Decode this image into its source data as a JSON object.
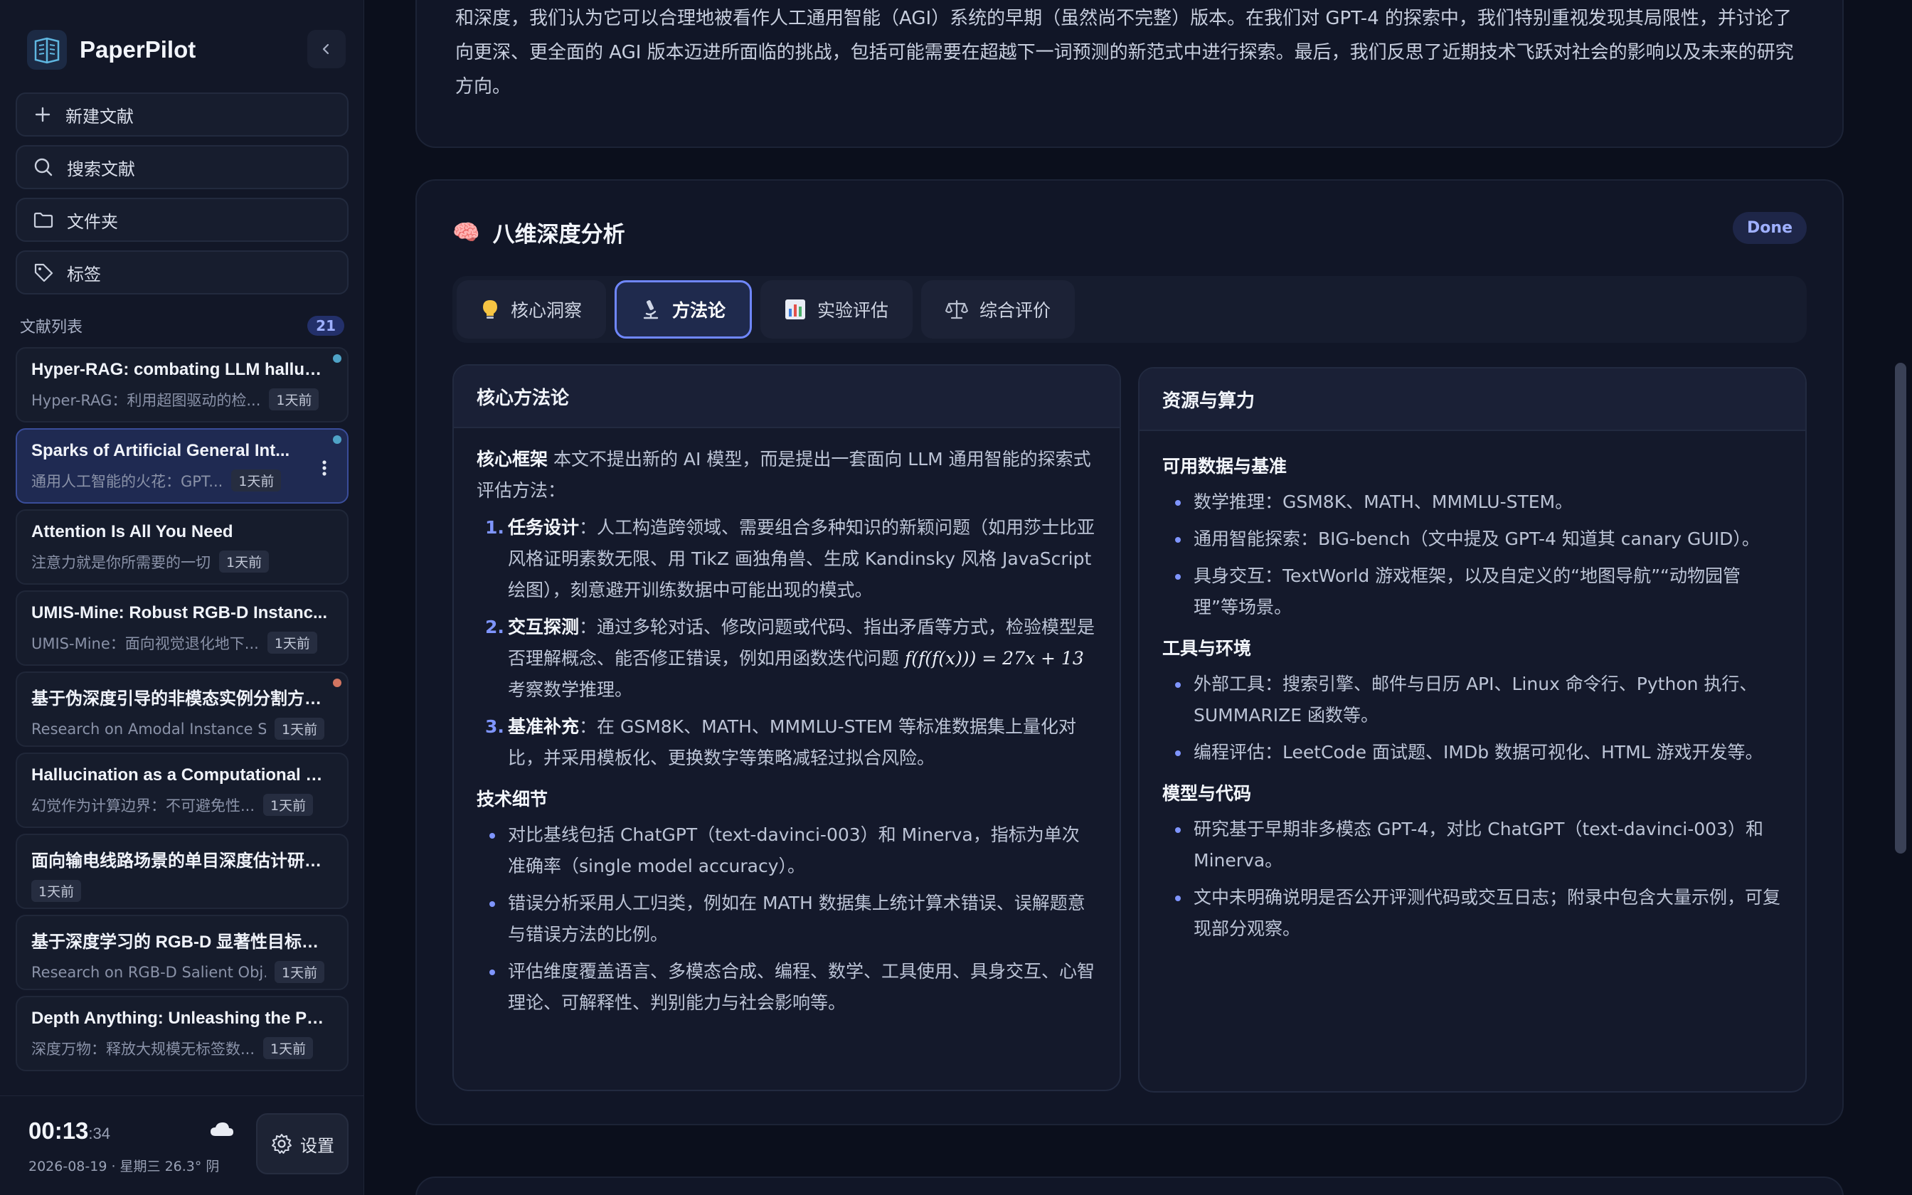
{
  "app": {
    "name": "PaperPilot"
  },
  "sidebar": {
    "nav": [
      {
        "label": "新建文献",
        "icon": "plus-icon"
      },
      {
        "label": "搜索文献",
        "icon": "search-icon"
      },
      {
        "label": "文件夹",
        "icon": "folder-icon"
      },
      {
        "label": "标签",
        "icon": "tag-icon"
      }
    ],
    "list_title": "文献列表",
    "list_count": "21",
    "docs": [
      {
        "title": "Hyper-RAG: combating LLM halluci...",
        "subtitle": "Hyper-RAG：利用超图驱动的检...",
        "time": "1天前",
        "dot": "#4fa3c7"
      },
      {
        "title": "Sparks of Artificial General Int...",
        "subtitle": "通用人工智能的火花：GPT...",
        "time": "1天前",
        "dot": "#4fa3c7"
      },
      {
        "title": "Attention Is All You Need",
        "subtitle": "注意力就是你所需要的一切",
        "time": "1天前"
      },
      {
        "title": "UMIS-Mine: Robust RGB-D Instanc...",
        "subtitle": "UMIS-Mine：面向视觉退化地下...",
        "time": "1天前"
      },
      {
        "title": "基于伪深度引导的非模态实例分割方法...",
        "subtitle": "Research on Amodal Instance S...",
        "time": "1天前",
        "dot": "#d27561"
      },
      {
        "title": "Hallucination as a Computational B...",
        "subtitle": "幻觉作为计算边界：不可避免性...",
        "time": "1天前"
      },
      {
        "title": "面向输电线路场景的单目深度估计研究...",
        "subtitle": "",
        "time": "1天前"
      },
      {
        "title": "基于深度学习的 RGB-D 显著性目标检...",
        "subtitle": "Research on RGB-D Salient Obj...",
        "time": "1天前"
      },
      {
        "title": "Depth Anything: Unleashing the Po...",
        "subtitle": "深度万物：释放大规模无标签数...",
        "time": "1天前"
      }
    ],
    "footer": {
      "clock_hm": "00:13",
      "clock_sec": ":34",
      "date_line": "2026-08-19 · 星期三  26.3° 阴",
      "weather_icon": "cloud-icon",
      "settings_label": "设置"
    }
  },
  "abstract": {
    "text": "和深度，我们认为它可以合理地被看作人工通用智能（AGI）系统的早期（虽然尚不完整）版本。在我们对 GPT-4 的探索中，我们特别重视发现其局限性，并讨论了向更深、更全面的 AGI 版本迈进所面临的挑战，包括可能需要在超越下一词预测的新范式中进行探索。最后，我们反思了近期技术飞跃对社会的影响以及未来的研究方向。"
  },
  "analysis": {
    "emoji": "🧠",
    "title": "八维深度分析",
    "status": "Done",
    "tabs": [
      {
        "label": "核心洞察",
        "icon": "lightbulb-icon"
      },
      {
        "label": "方法论",
        "icon": "microscope-icon",
        "active": true
      },
      {
        "label": "实验评估",
        "icon": "bar-chart-icon"
      },
      {
        "label": "综合评价",
        "icon": "scale-icon"
      }
    ],
    "left": {
      "title": "核心方法论",
      "intro_label": "核心框架",
      "intro_text": " 本文不提出新的 AI 模型，而是提出一套面向 LLM 通用智能的探索式评估方法：",
      "steps": [
        {
          "num": "1.",
          "label": "任务设计",
          "text": "：人工构造跨领域、需要组合多种知识的新颖问题（如用莎士比亚风格证明素数无限、用 TikZ 画独角兽、生成 Kandinsky 风格 JavaScript 绘图），刻意避开训练数据中可能出现的模式。"
        },
        {
          "num": "2.",
          "label": "交互探测",
          "text": "：通过多轮对话、修改问题或代码、指出矛盾等方式，检验模型是否理解概念、能否修正错误，例如用函数迭代问题 ",
          "math": "f(f(f(x))) = 27x + 13",
          "text2": " 考察数学推理。"
        },
        {
          "num": "3.",
          "label": "基准补充",
          "text": "：在 GSM8K、MATH、MMMLU-STEM 等标准数据集上量化对比，并采用模板化、更换数字等策略减轻过拟合风险。"
        }
      ],
      "tech_title": "技术细节",
      "tech_items": [
        "对比基线包括 ChatGPT（text-davinci-003）和 Minerva，指标为单次准确率（single model accuracy）。",
        "错误分析采用人工归类，例如在 MATH 数据集上统计算术错误、误解题意与错误方法的比例。",
        "评估维度覆盖语言、多模态合成、编程、数学、工具使用、具身交互、心智理论、可解释性、判别能力与社会影响等。"
      ]
    },
    "right": {
      "title": "资源与算力",
      "groups": [
        {
          "title": "可用数据与基准",
          "items": [
            "数学推理：GSM8K、MATH、MMMLU-STEM。",
            "通用智能探索：BIG-bench（文中提及 GPT-4 知道其 canary GUID）。",
            "具身交互：TextWorld 游戏框架，以及自定义的“地图导航”“动物园管理”等场景。"
          ]
        },
        {
          "title": "工具与环境",
          "items": [
            "外部工具：搜索引擎、邮件与日历 API、Linux 命令行、Python 执行、SUMMARIZE 函数等。",
            "编程评估：LeetCode 面试题、IMDb 数据可视化、HTML 游戏开发等。"
          ]
        },
        {
          "title": "模型与代码",
          "items": [
            "研究基于早期非多模态 GPT-4，对比 ChatGPT（text-davinci-003）和 Minerva。",
            "文中未明确说明是否公开评测代码或交互日志；附录中包含大量示例，可复现部分观察。"
          ]
        }
      ]
    }
  }
}
